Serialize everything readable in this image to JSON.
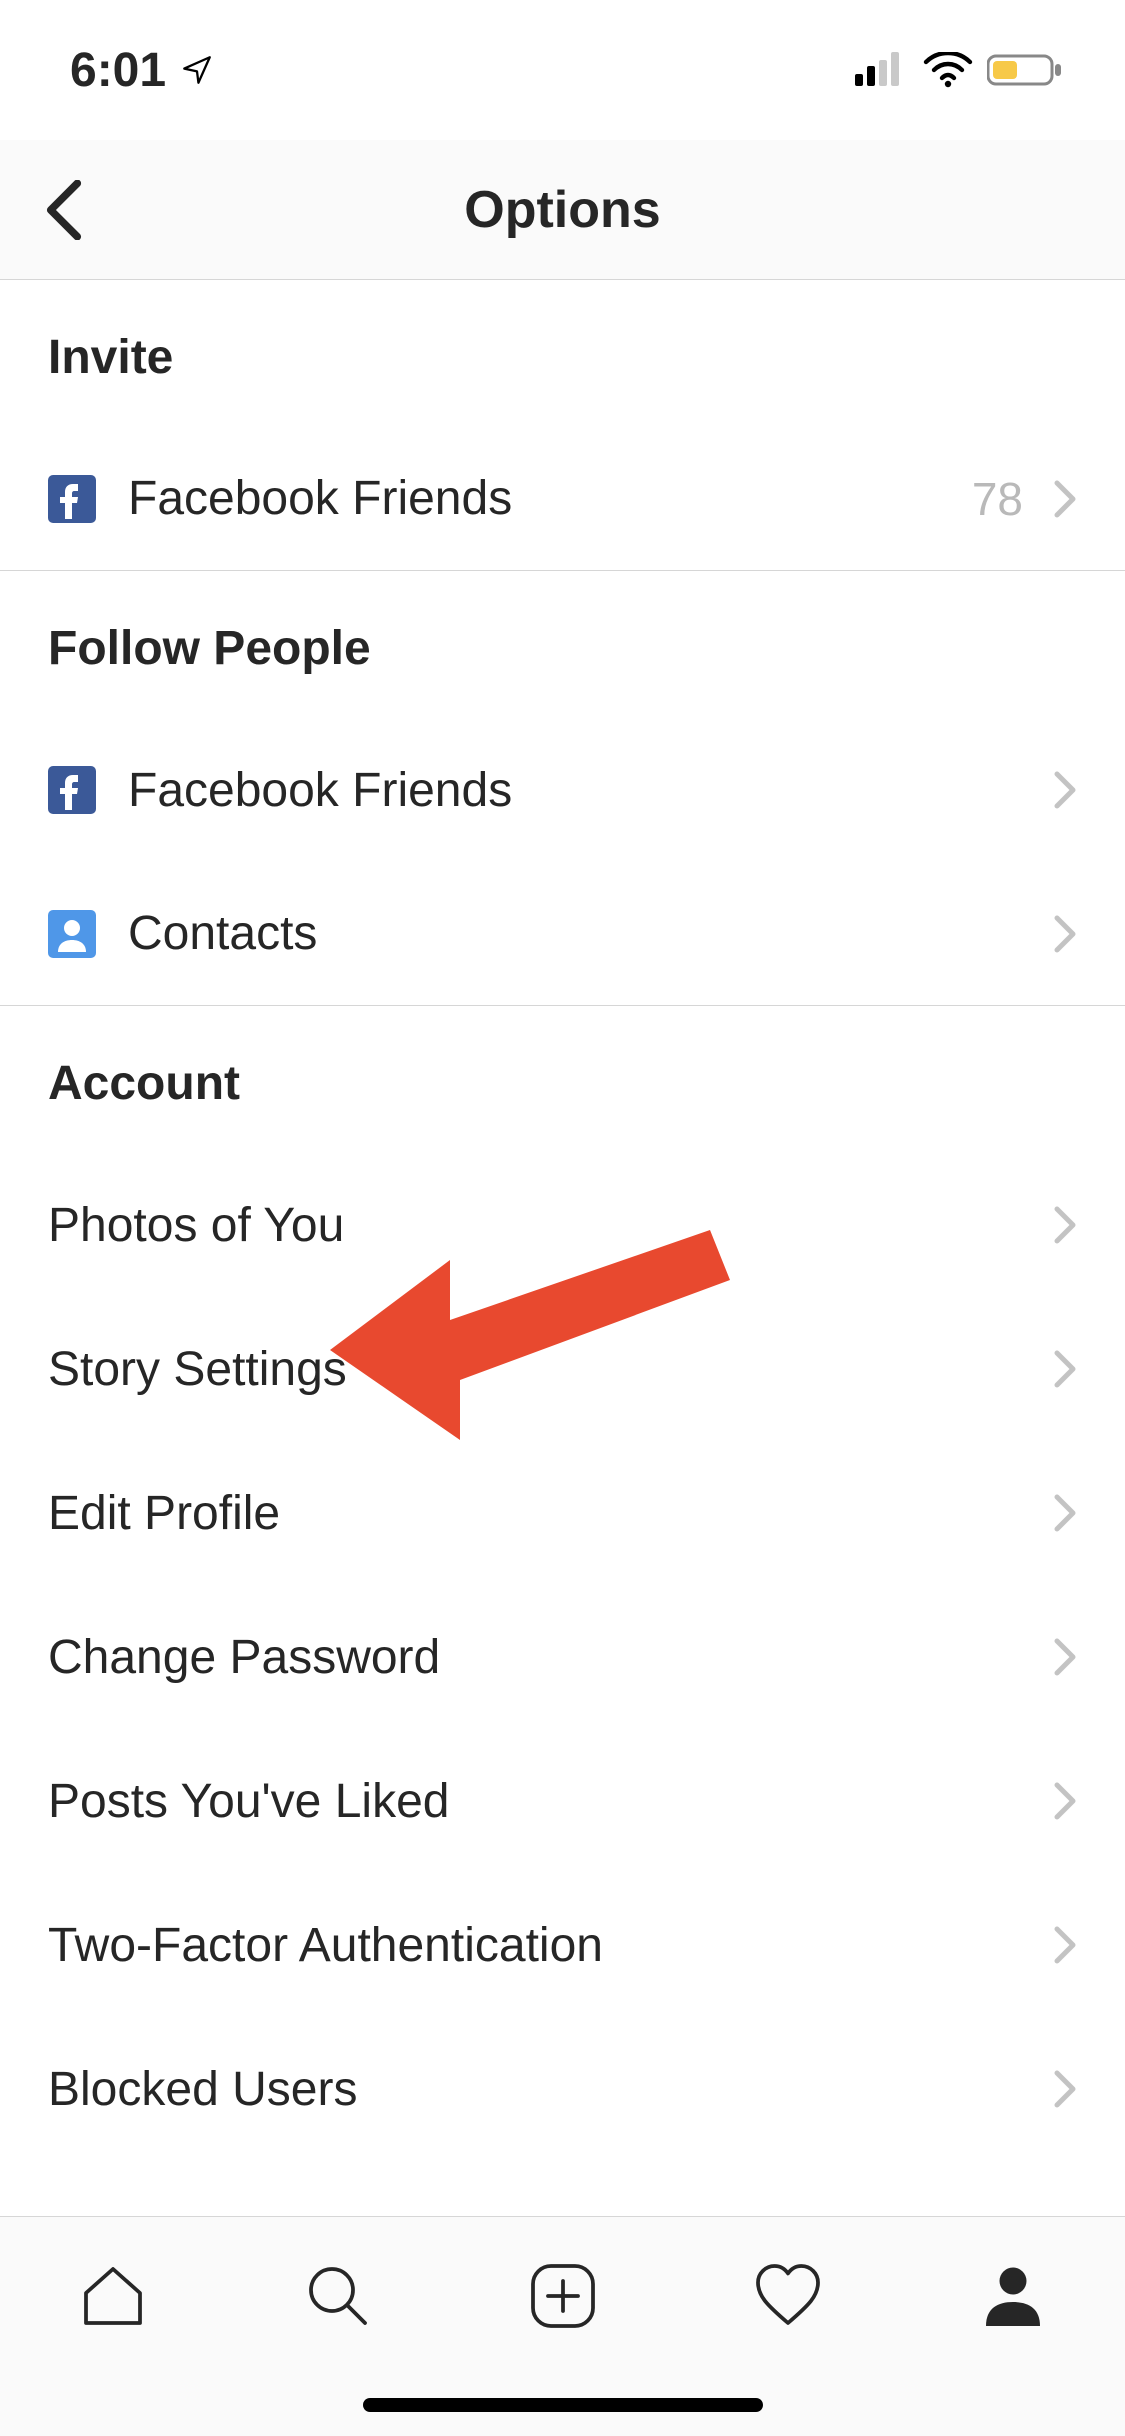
{
  "statusbar": {
    "time": "6:01"
  },
  "navbar": {
    "title": "Options"
  },
  "sections": {
    "invite": {
      "header": "Invite",
      "facebook_friends": {
        "label": "Facebook Friends",
        "count": "78"
      }
    },
    "follow": {
      "header": "Follow People",
      "facebook_friends": {
        "label": "Facebook Friends"
      },
      "contacts": {
        "label": "Contacts"
      }
    },
    "account": {
      "header": "Account",
      "photos_of_you": "Photos of You",
      "story_settings": "Story Settings",
      "edit_profile": "Edit Profile",
      "change_password": "Change Password",
      "posts_liked": "Posts You've Liked",
      "two_factor": "Two-Factor Authentication",
      "blocked_users": "Blocked Users"
    }
  },
  "annotation": {
    "points_to": "story-settings"
  }
}
